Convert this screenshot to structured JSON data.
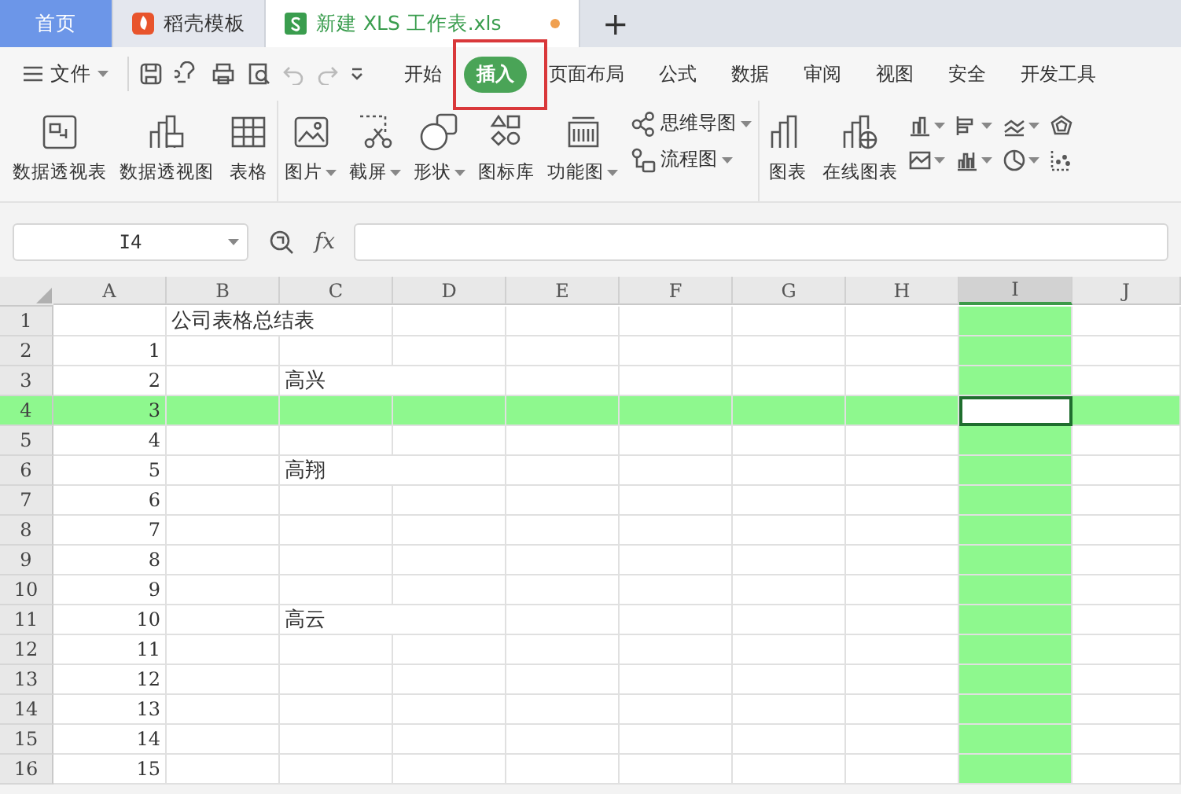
{
  "doc_tabs": [
    {
      "label": "首页",
      "kind": "home",
      "selected": false
    },
    {
      "label": "稻壳模板",
      "kind": "template",
      "selected": false
    },
    {
      "label": "新建 XLS 工作表.xls",
      "kind": "sheet",
      "selected": true,
      "unsaved": true
    }
  ],
  "new_tab": "+",
  "menu": {
    "file": "文件",
    "tabs": [
      {
        "label": "开始",
        "selected": false,
        "highlighted": false
      },
      {
        "label": "插入",
        "selected": true,
        "highlighted": true
      },
      {
        "label": "页面布局",
        "selected": false,
        "highlighted": false
      },
      {
        "label": "公式",
        "selected": false,
        "highlighted": false
      },
      {
        "label": "数据",
        "selected": false,
        "highlighted": false
      },
      {
        "label": "审阅",
        "selected": false,
        "highlighted": false
      },
      {
        "label": "视图",
        "selected": false,
        "highlighted": false
      },
      {
        "label": "安全",
        "selected": false,
        "highlighted": false
      },
      {
        "label": "开发工具",
        "selected": false,
        "highlighted": false
      }
    ]
  },
  "ribbon": [
    {
      "items": [
        {
          "kind": "large",
          "label": "数据透视表",
          "dropdown": false
        },
        {
          "kind": "large",
          "label": "数据透视图",
          "dropdown": false
        },
        {
          "kind": "large",
          "label": "表格",
          "dropdown": false
        }
      ]
    },
    {
      "items": [
        {
          "kind": "large",
          "label": "图片",
          "dropdown": true
        },
        {
          "kind": "large",
          "label": "截屏",
          "dropdown": true
        },
        {
          "kind": "large",
          "label": "形状",
          "dropdown": true
        },
        {
          "kind": "large",
          "label": "图标库",
          "dropdown": false
        },
        {
          "kind": "large",
          "label": "功能图",
          "dropdown": true
        },
        {
          "kind": "small",
          "label": "思维导图",
          "dropdown": true
        },
        {
          "kind": "small",
          "label": "流程图",
          "dropdown": true
        }
      ]
    },
    {
      "items": [
        {
          "kind": "large",
          "label": "图表",
          "dropdown": false
        },
        {
          "kind": "large",
          "label": "在线图表",
          "dropdown": false
        },
        {
          "kind": "icon",
          "dropdown": true
        },
        {
          "kind": "icon",
          "dropdown": true
        },
        {
          "kind": "icon",
          "dropdown": true
        },
        {
          "kind": "icon",
          "dropdown": false
        },
        {
          "kind": "icon",
          "dropdown": true
        },
        {
          "kind": "icon",
          "dropdown": true
        },
        {
          "kind": "icon",
          "dropdown": true
        },
        {
          "kind": "icon",
          "dropdown": false
        }
      ]
    }
  ],
  "formula_bar": {
    "name_box": "I4",
    "fx": "fx"
  },
  "columns": [
    {
      "label": "A",
      "selected": false
    },
    {
      "label": "B",
      "selected": false
    },
    {
      "label": "C",
      "selected": false
    },
    {
      "label": "D",
      "selected": false
    },
    {
      "label": "E",
      "selected": false
    },
    {
      "label": "F",
      "selected": false
    },
    {
      "label": "G",
      "selected": false
    },
    {
      "label": "H",
      "selected": false
    },
    {
      "label": "I",
      "selected": true
    },
    {
      "label": "J",
      "selected": false
    }
  ],
  "rows": [
    {
      "label": "1",
      "selected": false,
      "cells": [
        null,
        "公司表格总结表"
      ]
    },
    {
      "label": "2",
      "selected": false,
      "cells": [
        "1"
      ]
    },
    {
      "label": "3",
      "selected": false,
      "cells": [
        "2",
        null,
        "高兴"
      ]
    },
    {
      "label": "4",
      "selected": true,
      "cells": [
        "3"
      ]
    },
    {
      "label": "5",
      "selected": false,
      "cells": [
        "4"
      ]
    },
    {
      "label": "6",
      "selected": false,
      "cells": [
        "5",
        null,
        "高翔"
      ]
    },
    {
      "label": "7",
      "selected": false,
      "cells": [
        "6"
      ]
    },
    {
      "label": "8",
      "selected": false,
      "cells": [
        "7"
      ]
    },
    {
      "label": "9",
      "selected": false,
      "cells": [
        "8"
      ]
    },
    {
      "label": "10",
      "selected": false,
      "cells": [
        "9"
      ]
    },
    {
      "label": "11",
      "selected": false,
      "cells": [
        "10",
        null,
        "高云"
      ]
    },
    {
      "label": "12",
      "selected": false,
      "cells": [
        "11"
      ]
    },
    {
      "label": "13",
      "selected": false,
      "cells": [
        "12"
      ]
    },
    {
      "label": "14",
      "selected": false,
      "cells": [
        "13"
      ]
    },
    {
      "label": "15",
      "selected": false,
      "cells": [
        "14"
      ]
    },
    {
      "label": "16",
      "selected": false,
      "cells": [
        "15"
      ]
    }
  ]
}
